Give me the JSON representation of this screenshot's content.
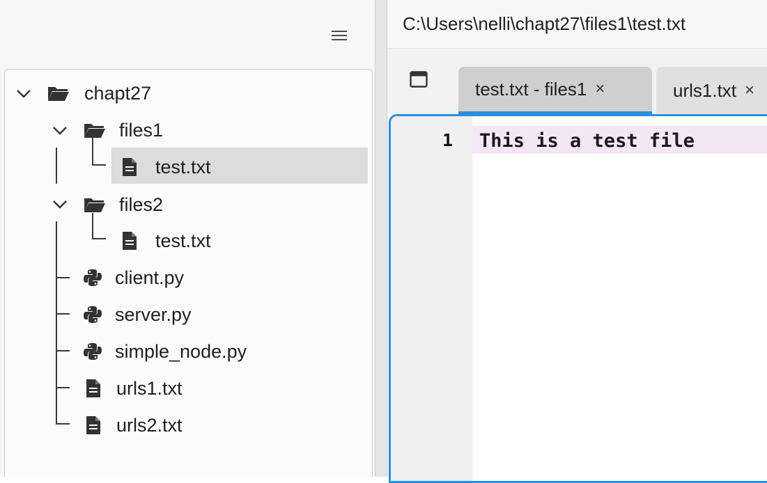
{
  "explorer": {
    "menu_icon": "hamburger-menu-icon",
    "tree": {
      "root": {
        "label": "chapt27",
        "icon": "folder-open-icon",
        "expanded": true
      },
      "files1": {
        "label": "files1",
        "icon": "folder-open-icon",
        "expanded": true
      },
      "files1_test": {
        "label": "test.txt",
        "icon": "file-text-icon",
        "selected": true
      },
      "files2": {
        "label": "files2",
        "icon": "folder-open-icon",
        "expanded": true
      },
      "files2_test": {
        "label": "test.txt",
        "icon": "file-text-icon"
      },
      "client": {
        "label": "client.py",
        "icon": "python-icon"
      },
      "server": {
        "label": "server.py",
        "icon": "python-icon"
      },
      "simple_node": {
        "label": "simple_node.py",
        "icon": "python-icon"
      },
      "urls1": {
        "label": "urls1.txt",
        "icon": "file-text-icon"
      },
      "urls2": {
        "label": "urls2.txt",
        "icon": "file-text-icon"
      }
    }
  },
  "editor": {
    "path": "C:\\Users\\nelli\\chapt27\\files1\\test.txt",
    "tabs": [
      {
        "label": "test.txt - files1",
        "close": "×",
        "active": true
      },
      {
        "label": "urls1.txt",
        "close": "×",
        "active": false
      }
    ],
    "lines": [
      {
        "number": "1",
        "text": "This is a test file"
      }
    ]
  },
  "colors": {
    "accent": "#2b8fe0",
    "selection": "#dcdcdc",
    "current_line": "#f4e6f4"
  }
}
